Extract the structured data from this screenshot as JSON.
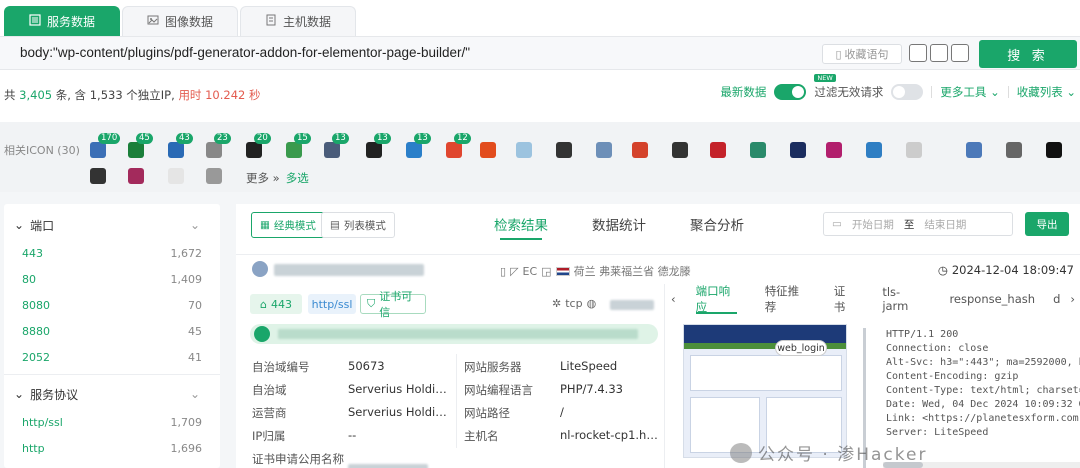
{
  "tabs": [
    {
      "label": "服务数据",
      "icon": "list-icon",
      "active": true
    },
    {
      "label": "图像数据",
      "icon": "image-icon",
      "active": false
    },
    {
      "label": "主机数据",
      "icon": "server-icon",
      "active": false
    }
  ],
  "search": {
    "query": "body:\"wp-content/plugins/pdf-generator-addon-for-elementor-page-builder/\"",
    "fav_label": "收藏语句",
    "button_label": "搜 索"
  },
  "stats": {
    "prefix": "共 ",
    "total": "3,405",
    "mid": " 条, 含 1,533 个独立IP, ",
    "time_label": "用时 10.242 秒"
  },
  "controls": {
    "latest": "最新数据",
    "new_badge": "NEW",
    "filter": "过滤无效请求",
    "tools": "更多工具",
    "fav_list": "收藏列表"
  },
  "icons": {
    "label": "相关ICON (30)",
    "more": "更多",
    "multi": "多选",
    "counts": [
      "170",
      "45",
      "43",
      "23",
      "20",
      "15",
      "13",
      "13",
      "13",
      "12"
    ]
  },
  "facets": {
    "port_title": "端口",
    "ports": [
      {
        "k": "443",
        "v": "1,672"
      },
      {
        "k": "80",
        "v": "1,409"
      },
      {
        "k": "8080",
        "v": "70"
      },
      {
        "k": "8880",
        "v": "45"
      },
      {
        "k": "2052",
        "v": "41"
      }
    ],
    "proto_title": "服务协议",
    "protos": [
      {
        "k": "http/ssl",
        "v": "1,709"
      },
      {
        "k": "http",
        "v": "1,696"
      }
    ]
  },
  "main": {
    "mode_classic": "经典模式",
    "mode_list": "列表模式",
    "tabs": [
      "检索结果",
      "数据统计",
      "聚合分析"
    ],
    "date_start": "开始日期",
    "date_to": "至",
    "date_end": "结束日期",
    "export": "导出"
  },
  "result": {
    "location": "荷兰 弗莱福兰省 德龙滕",
    "time": "2024-12-04 18:09:47",
    "port": "443",
    "proto": "http/ssl",
    "cert": "证书可信",
    "transport": "tcp",
    "fields_left": [
      {
        "k": "自治域编号",
        "v": "50673"
      },
      {
        "k": "自治域",
        "v": "Serverius Holding..."
      },
      {
        "k": "运营商",
        "v": "Serverius Holding..."
      },
      {
        "k": "IP归属",
        "v": "--"
      },
      {
        "k": "证书申请公用名称",
        "v": ""
      }
    ],
    "fields_right": [
      {
        "k": "网站服务器",
        "v": "LiteSpeed"
      },
      {
        "k": "网站编程语言",
        "v": "PHP/7.4.33"
      },
      {
        "k": "网站路径",
        "v": "/"
      },
      {
        "k": "主机名",
        "v": "nl-rocket-cp1.host..."
      }
    ],
    "rtabs": [
      "端口响应",
      "特征推荐",
      "证书",
      "tls-jarm",
      "response_hash",
      "d"
    ],
    "shot_label": "web_login",
    "response": "HTTP/1.1 200\nConnection: close\nAlt-Svc: h3=\":443\"; ma=2592000, h3\nContent-Encoding: gzip\nContent-Type: text/html; charset=U\nDate: Wed, 04 Dec 2024 10:09:32 GM\nLink: <https://planetesxform.com\nServer: LiteSpeed"
  },
  "watermark": "公众号 · 渗Hacker"
}
